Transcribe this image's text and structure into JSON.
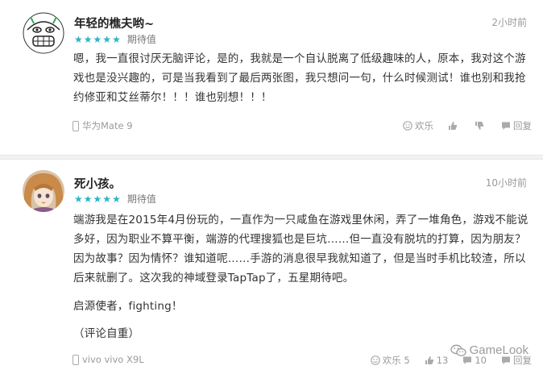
{
  "reviews": [
    {
      "username": "年轻的樵夫哟~",
      "time": "2小时前",
      "rating_stars": 5,
      "rating_label": "期待值",
      "body": [
        "嗯，我一直很讨厌无脑评论，是的，我就是一个自认脱离了低级趣味的人，原本，我对这个游戏也是没兴趣的，可是当我看到了最后两张图，我只想问一句，什么时候测试！谁也别和我抢约修亚和艾丝蒂尔！！！谁也别想！！！"
      ],
      "device": "华为Mate 9",
      "actions": {
        "funny": "欢乐",
        "up": "",
        "down": "",
        "reply": "回复"
      }
    },
    {
      "username": "死小孩。",
      "time": "10小时前",
      "rating_stars": 5,
      "rating_label": "期待值",
      "body": [
        "端游我是在2015年4月份玩的，一直作为一只咸鱼在游戏里休闲，弄了一堆角色，游戏不能说多好，因为职业不算平衡，端游的代理搜狐也是巨坑……但一直没有脱坑的打算，因为朋友？因为故事？因为情怀？谁知道呢……手游的消息很早我就知道了，但是当时手机比较渣，所以后来就删了。这次我的神域登录TapTap了，五星期待吧。",
        "启源使者，fighting！",
        "（评论自重）"
      ],
      "device": "vivo vivo X9L",
      "actions": {
        "funny": "欢乐 5",
        "up": "13",
        "down": "10",
        "reply": "回复"
      }
    }
  ],
  "watermark": "GameLook",
  "colors": {
    "star": "#2cb4c2",
    "muted": "#9a9a9a",
    "text": "#333333"
  },
  "icons": [
    "smiley-icon",
    "thumb-up-icon",
    "thumb-down-icon",
    "comment-icon",
    "phone-icon",
    "wechat-icon"
  ]
}
